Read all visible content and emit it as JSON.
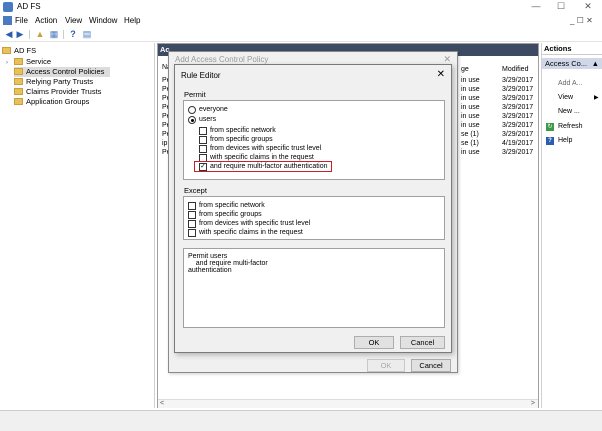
{
  "window": {
    "title": "AD FS",
    "minimize": "—",
    "maximize": "☐",
    "close": "✕",
    "inner_controls": "_ ☐ ✕"
  },
  "menu": [
    "File",
    "Action",
    "View",
    "Window",
    "Help"
  ],
  "tree": {
    "root": "AD FS",
    "items": [
      "Service",
      "Access Control Policies",
      "Relying Party Trusts",
      "Claims Provider Trusts",
      "Application Groups"
    ]
  },
  "center": {
    "header": "Ac",
    "col_name": "Na",
    "col_usage": "ge",
    "col_modified": "Modified",
    "rows": [
      {
        "name": "Pe",
        "usage": "in use",
        "modified": "3/29/2017"
      },
      {
        "name": "Pe",
        "usage": "in use",
        "modified": "3/29/2017"
      },
      {
        "name": "Pe",
        "usage": "in use",
        "modified": "3/29/2017"
      },
      {
        "name": "Pe",
        "usage": "in use",
        "modified": "3/29/2017"
      },
      {
        "name": "Pe",
        "usage": "in use",
        "modified": "3/29/2017"
      },
      {
        "name": "Pe",
        "usage": "in use",
        "modified": "3/29/2017"
      },
      {
        "name": "Pe",
        "usage": "se (1)",
        "modified": "3/29/2017"
      },
      {
        "name": "ip",
        "usage": "se (1)",
        "modified": "4/19/2017"
      },
      {
        "name": "Pe",
        "usage": "in use",
        "modified": "3/29/2017"
      }
    ],
    "scroll_left": "<",
    "scroll_right": ">"
  },
  "actions": {
    "header": "Actions",
    "group": "Access Co...",
    "group_arrow": "▲",
    "items": [
      "Add A...",
      "View",
      "New ...",
      "Refresh",
      "Help"
    ],
    "view_arrow": "▶"
  },
  "dialog_back": {
    "title": "Add Access Control Policy",
    "close": "✕",
    "ok": "OK",
    "cancel": "Cancel"
  },
  "rule_editor": {
    "title": "Rule Editor",
    "close": "✕",
    "permit_label": "Permit",
    "radio_everyone": "everyone",
    "radio_users": "users",
    "permit_options": [
      {
        "label": "from specific network",
        "checked": false
      },
      {
        "label": "from specific groups",
        "checked": false
      },
      {
        "label": "from devices with specific trust level",
        "checked": false
      },
      {
        "label": "with specific claims in the request",
        "checked": false
      },
      {
        "label": "and require multi-factor authentication",
        "checked": true
      }
    ],
    "except_label": "Except",
    "except_options": [
      {
        "label": "from specific network",
        "checked": false
      },
      {
        "label": "from specific groups",
        "checked": false
      },
      {
        "label": "from devices with specific trust level",
        "checked": false
      },
      {
        "label": "with specific claims in the request",
        "checked": false
      }
    ],
    "summary": [
      "Permit users",
      "    and require multi-factor",
      "authentication"
    ],
    "ok": "OK",
    "cancel": "Cancel",
    "checkmark": "✓"
  },
  "colors": {
    "center_header_bg": "#3c4a63",
    "highlight_border": "#c8202a",
    "actions_group_bg": "#cfd7e8"
  }
}
